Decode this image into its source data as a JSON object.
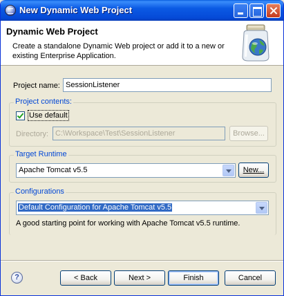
{
  "window": {
    "title": "New Dynamic Web Project",
    "colors": {
      "titlebar": "#0549d6",
      "accent": "#0046d5",
      "selection": "#316ac5"
    }
  },
  "banner": {
    "title": "Dynamic Web Project",
    "description": "Create a standalone Dynamic Web project or add it to a new or existing Enterprise Application.",
    "icon": "web-project-jar-icon"
  },
  "project_name": {
    "label": "Project name:",
    "value": "SessionListener"
  },
  "project_contents": {
    "title": "Project contents:",
    "use_default_label": "Use default",
    "use_default_checked": true,
    "directory_label": "Directory:",
    "directory_value": "C:\\Workspace\\Test\\SessionListener",
    "browse_label": "Browse..."
  },
  "target_runtime": {
    "title": "Target Runtime",
    "selected": "Apache Tomcat v5.5",
    "new_label": "New..."
  },
  "configurations": {
    "title": "Configurations",
    "selected": "Default Configuration for Apache Tomcat v5.5",
    "description": "A good starting point for working with Apache Tomcat v5.5 runtime."
  },
  "footer": {
    "help_icon": "help-icon",
    "help_glyph": "?",
    "back_label": "< Back",
    "next_label": "Next >",
    "finish_label": "Finish",
    "cancel_label": "Cancel"
  }
}
